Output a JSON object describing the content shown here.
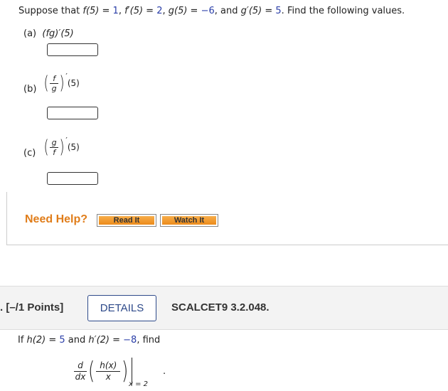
{
  "question1": {
    "prefix": "Suppose that ",
    "givens": [
      {
        "lhs": "f(5) = ",
        "val": "1",
        "sep": ", "
      },
      {
        "lhs": "f′(5) = ",
        "val": "2",
        "sep": ", "
      },
      {
        "lhs": "g(5) = ",
        "val": "−6",
        "sep": ", and "
      },
      {
        "lhs": "g′(5) = ",
        "val": "5",
        "sep": ". "
      }
    ],
    "suffix": "Find the following values.",
    "parts": [
      {
        "label": "(a)",
        "expr": "(fg)′(5)"
      },
      {
        "label": "(b)",
        "num": "f",
        "den": "g",
        "prime": "′",
        "arg": "(5)"
      },
      {
        "label": "(c)",
        "num": "g",
        "den": "f",
        "prime": "′",
        "arg": "(5)"
      }
    ],
    "need_help": "Need Help?",
    "read_it": "Read It",
    "watch_it": "Watch It"
  },
  "question2": {
    "points": "[–/1 Points]",
    "details": "DETAILS",
    "code": "SCALCET9 3.2.048.",
    "text_pre": "If ",
    "h2_lhs": "h(2) = ",
    "h2_val": "5",
    "mid": " and ",
    "hp2_lhs": "h′(2) = ",
    "hp2_val": "−8",
    "text_post": ", find",
    "d_num": "d",
    "d_den": "dx",
    "inner_num": "h(x)",
    "inner_den": "x",
    "eval_at": "x = 2",
    "period": "."
  },
  "colors": {
    "highlight": "#2a3ea8",
    "help_orange": "#e07d1a",
    "details_border": "#2e4a8a"
  }
}
